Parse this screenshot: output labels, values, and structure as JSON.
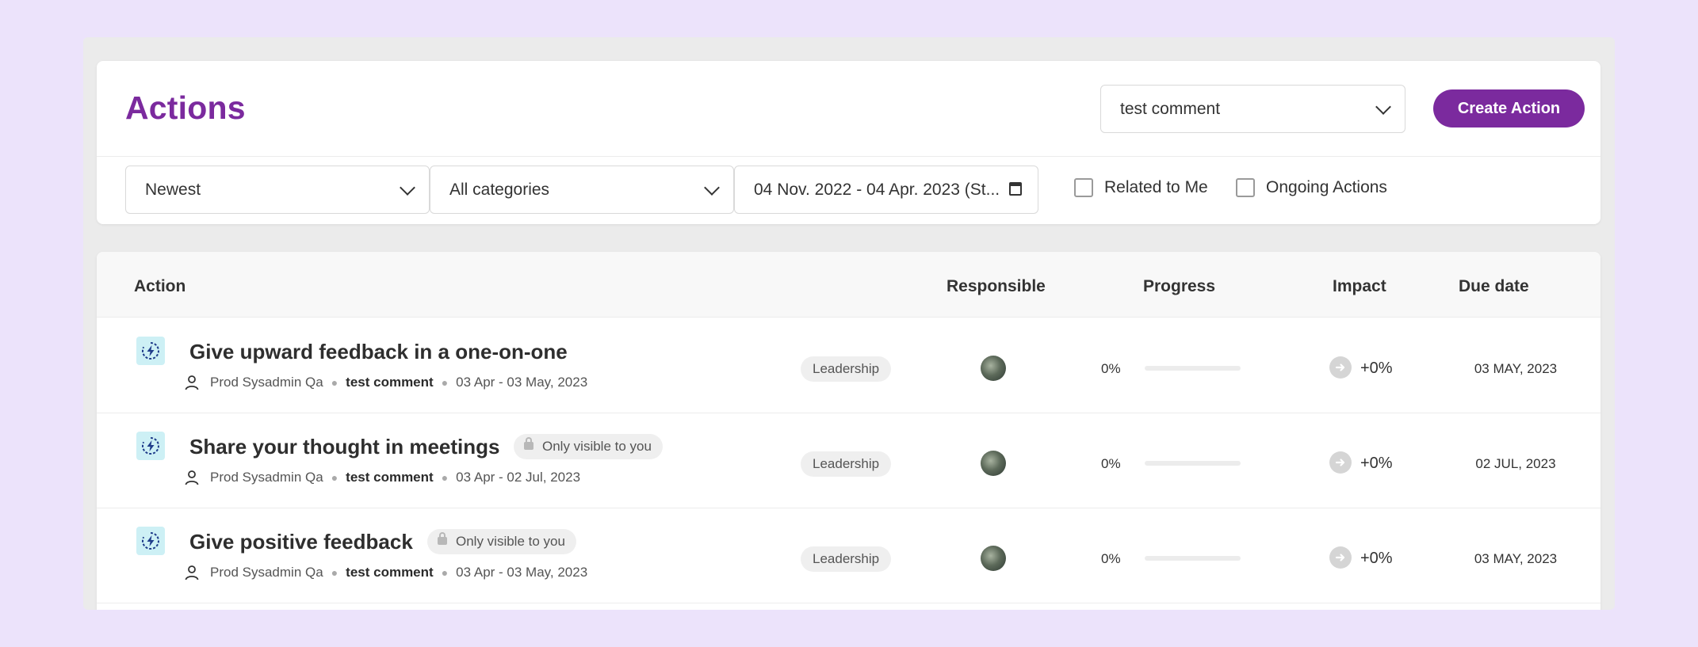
{
  "header": {
    "title": "Actions",
    "comment_filter": "test comment",
    "create_button": "Create Action"
  },
  "filters": {
    "sort": "Newest",
    "category": "All categories",
    "date_range": "04 Nov. 2022 - 04 Apr. 2023 (St...",
    "related_to_me": "Related to Me",
    "ongoing_actions": "Ongoing Actions"
  },
  "table": {
    "columns": {
      "action": "Action",
      "responsible": "Responsible",
      "progress": "Progress",
      "impact": "Impact",
      "due_date": "Due date"
    },
    "rows": [
      {
        "title": "Give upward feedback in a one-on-one",
        "visibility": "",
        "owner": "Prod Sysadmin Qa",
        "comment": "test comment",
        "period": "03 Apr - 03 May, 2023",
        "category": "Leadership",
        "progress_label": "0%",
        "progress": 0,
        "impact": "+0%",
        "due": "03 MAY, 2023"
      },
      {
        "title": "Share your thought in meetings",
        "visibility": "Only visible to you",
        "owner": "Prod Sysadmin Qa",
        "comment": "test comment",
        "period": "03 Apr - 02 Jul, 2023",
        "category": "Leadership",
        "progress_label": "0%",
        "progress": 0,
        "impact": "+0%",
        "due": "02 JUL, 2023"
      },
      {
        "title": "Give positive feedback",
        "visibility": "Only visible to you",
        "owner": "Prod Sysadmin Qa",
        "comment": "test comment",
        "period": "03 Apr - 03 May, 2023",
        "category": "Leadership",
        "progress_label": "0%",
        "progress": 0,
        "impact": "+0%",
        "due": "03 MAY, 2023"
      }
    ]
  },
  "colors": {
    "brand": "#7b2a9e",
    "page_background": "#ece3fb",
    "action_icon_bg": "#cdf0f5",
    "action_icon_fg": "#1f3c8a"
  },
  "icons": {
    "action": "lightning-cycle-icon",
    "owner": "person-icon",
    "visibility": "lock-icon",
    "impact": "arrow-right-circle-icon",
    "date": "calendar-icon",
    "dropdown": "chevron-down-icon"
  }
}
